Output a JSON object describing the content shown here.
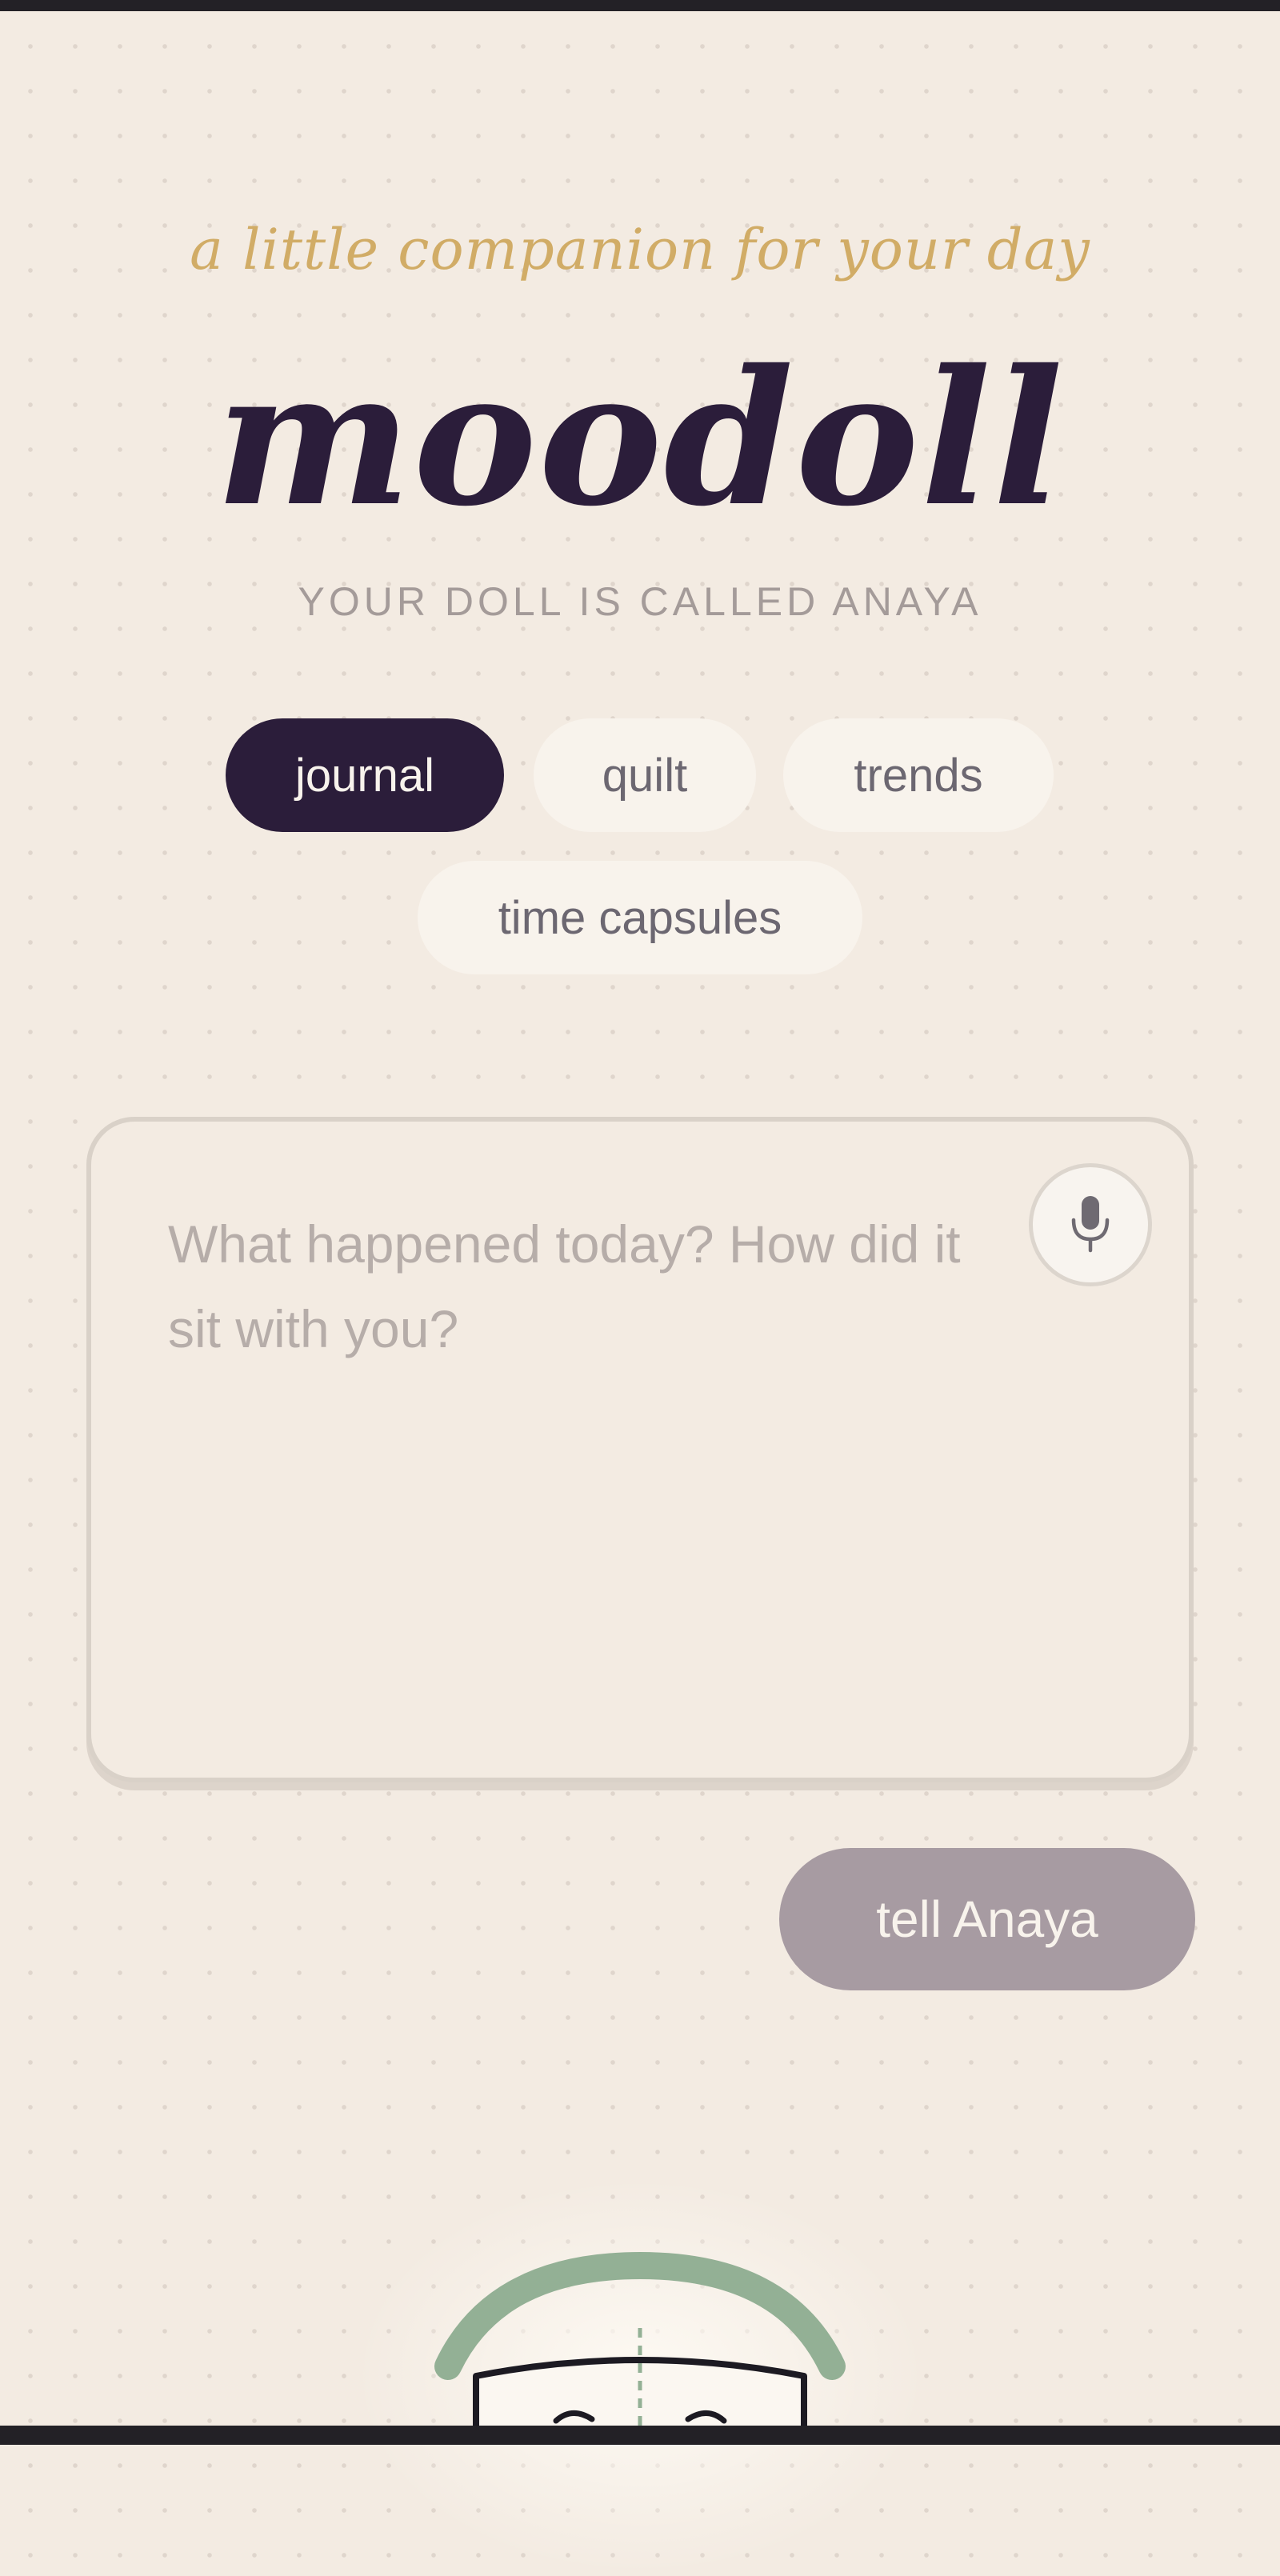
{
  "header": {
    "tagline": "a little companion for your day",
    "title": "moodoll",
    "subtitle": "YOUR DOLL IS CALLED ANAYA"
  },
  "tabs": [
    {
      "label": "journal",
      "active": true
    },
    {
      "label": "quilt",
      "active": false
    },
    {
      "label": "trends",
      "active": false
    },
    {
      "label": "time capsules",
      "active": false
    }
  ],
  "journal": {
    "placeholder": "What happened today? How did it sit with you?",
    "value": "",
    "mic_icon": "microphone-icon",
    "send_label": "tell Anaya"
  },
  "doll": {
    "icon": "doll-illustration",
    "hair_color": "#93b095"
  },
  "colors": {
    "background": "#f3ebe2",
    "accent_dark": "#2b1d3a",
    "accent_gold": "#d1ac66",
    "button_muted": "#a79ba2"
  }
}
